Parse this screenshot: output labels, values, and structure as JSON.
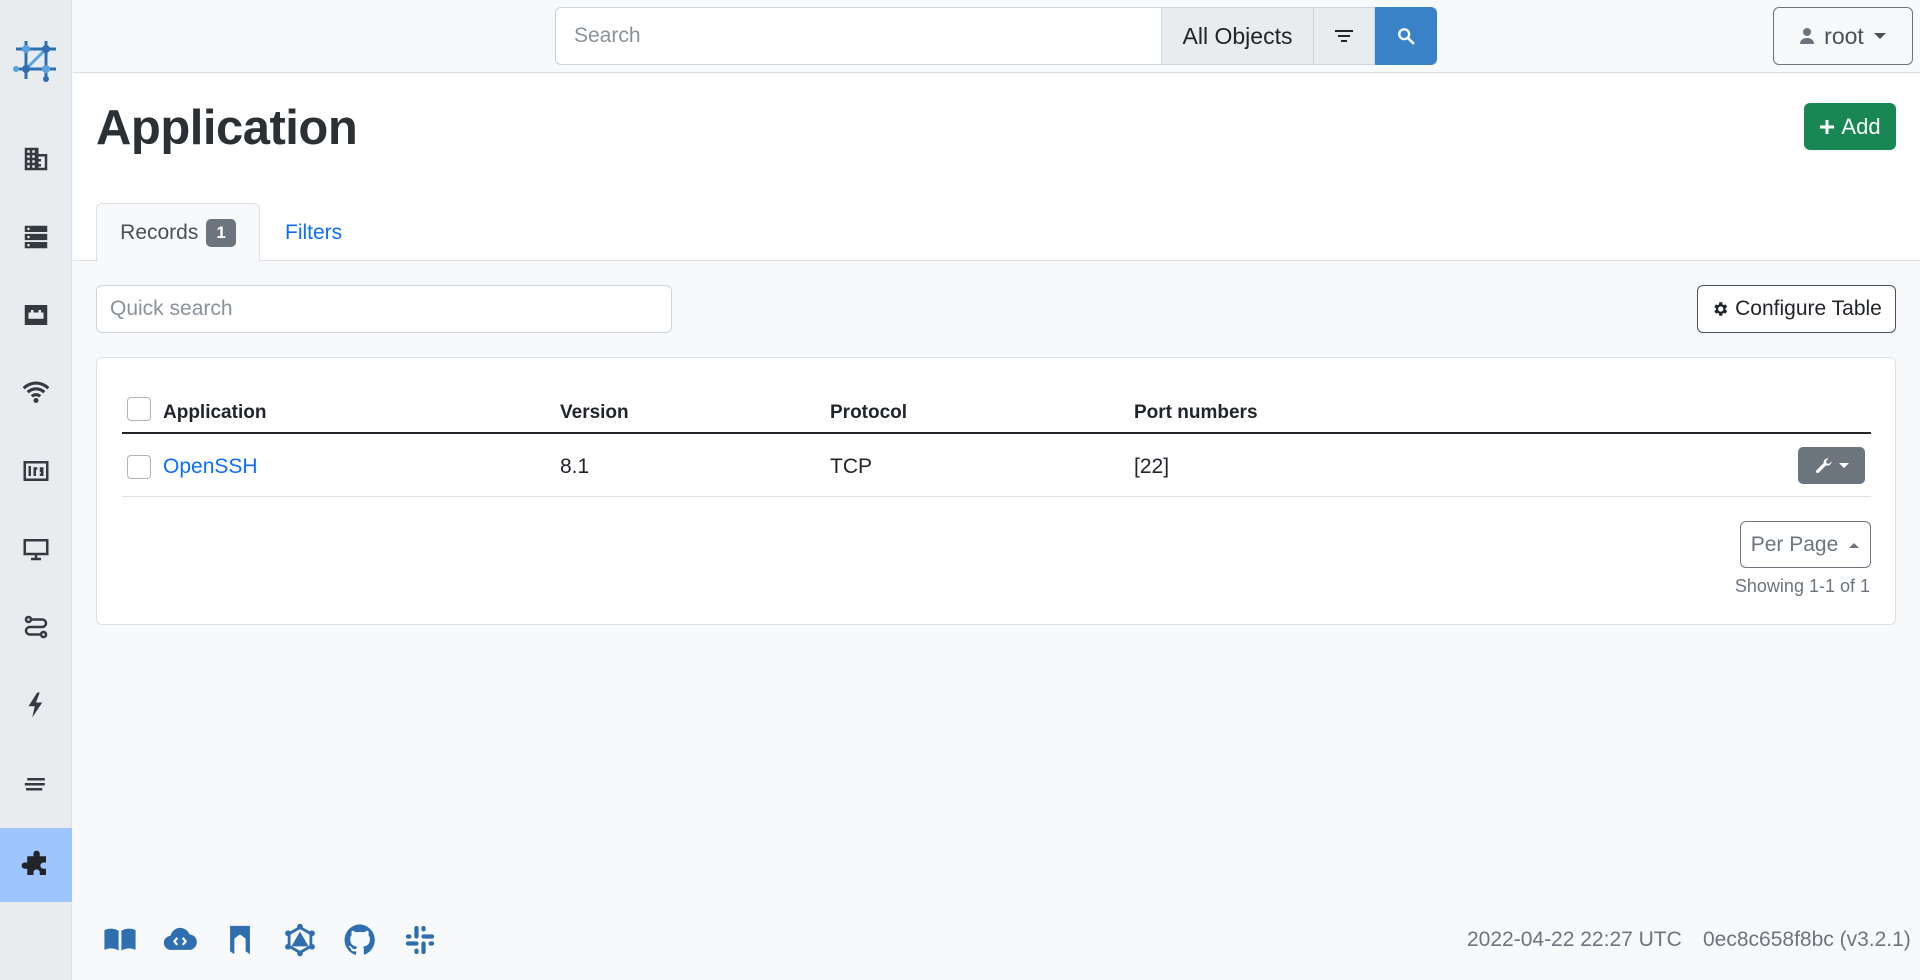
{
  "topbar": {
    "search_placeholder": "Search",
    "scope": "All Objects",
    "user": "root"
  },
  "page": {
    "title": "Application",
    "add_label": "Add"
  },
  "tabs": {
    "records_label": "Records",
    "records_count": "1",
    "filters_label": "Filters"
  },
  "toolbar": {
    "quick_search_placeholder": "Quick search",
    "configure_label": "Configure Table"
  },
  "table": {
    "columns": [
      "Application",
      "Version",
      "Protocol",
      "Port numbers"
    ],
    "rows": [
      {
        "application": "OpenSSH",
        "version": "8.1",
        "protocol": "TCP",
        "ports": "[22]"
      }
    ]
  },
  "pagination": {
    "per_page_label": "Per Page",
    "showing": "Showing 1-1 of 1"
  },
  "footer": {
    "timestamp": "2022-04-22 22:27 UTC",
    "version": "0ec8c658f8bc (v3.2.1)"
  },
  "colors": {
    "primary": "#0d6efd",
    "success": "#198754",
    "secondary": "#6c757d",
    "sidebar_active": "#9ec5fe"
  },
  "icons": {
    "sidebar": [
      "building-icon",
      "server-icon",
      "ethernet-port-icon",
      "wifi-icon",
      "circuit-icon",
      "monitor-icon",
      "route-icon",
      "lightning-icon",
      "lines-icon",
      "puzzle-icon"
    ],
    "footer": [
      "book-icon",
      "cloud-api-icon",
      "bookmark-icon",
      "graphql-icon",
      "github-icon",
      "slack-icon"
    ]
  }
}
